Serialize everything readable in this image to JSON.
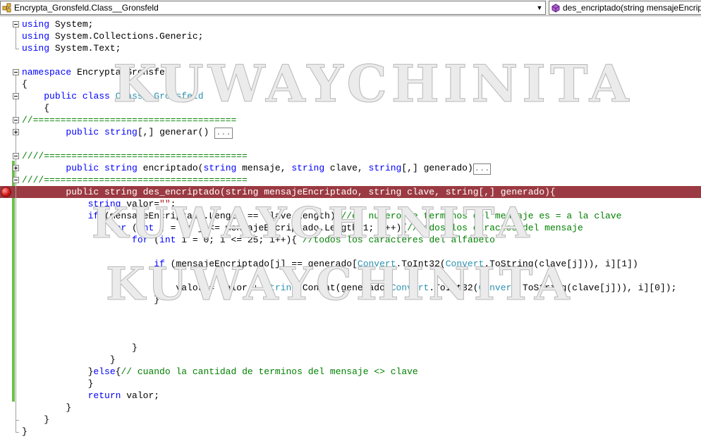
{
  "navigation": {
    "type_selector": "Encrypta_Gronsfeld.Class__Gronsfeld",
    "member_selector": "des_encriptado(string mensajeEncriptado, string clave, string[,] generado)",
    "dropdown_arrow": "▼"
  },
  "watermark": {
    "text": "KUWAYCHINITA"
  },
  "code_lines": [
    [
      {
        "t": "using",
        "c": "kw"
      },
      {
        "t": " System;"
      }
    ],
    [
      {
        "t": "using",
        "c": "kw"
      },
      {
        "t": " System.Collections.Generic;"
      }
    ],
    [
      {
        "t": "using",
        "c": "kw"
      },
      {
        "t": " System.Text;"
      }
    ],
    [
      {
        "t": ""
      }
    ],
    [
      {
        "t": "namespace",
        "c": "kw"
      },
      {
        "t": " Encrypta_Gronsfeld"
      }
    ],
    [
      {
        "t": "{"
      }
    ],
    [
      {
        "t": "    "
      },
      {
        "t": "public",
        "c": "kw"
      },
      {
        "t": " "
      },
      {
        "t": "class",
        "c": "kw"
      },
      {
        "t": " "
      },
      {
        "t": "Class__Gronsfeld",
        "c": "ty"
      }
    ],
    [
      {
        "t": "    {"
      }
    ],
    [
      {
        "t": "//=====================================",
        "c": "cm"
      }
    ],
    [
      {
        "t": "        "
      },
      {
        "t": "public",
        "c": "kw"
      },
      {
        "t": " "
      },
      {
        "t": "string",
        "c": "kw"
      },
      {
        "t": "[,] generar() "
      },
      {
        "t": "...",
        "c": "ellipsis"
      }
    ],
    [
      {
        "t": ""
      }
    ],
    [
      {
        "t": "////=====================================",
        "c": "cm"
      }
    ],
    [
      {
        "t": "        "
      },
      {
        "t": "public",
        "c": "kw"
      },
      {
        "t": " "
      },
      {
        "t": "string",
        "c": "kw"
      },
      {
        "t": " encriptado("
      },
      {
        "t": "string",
        "c": "kw"
      },
      {
        "t": " mensaje, "
      },
      {
        "t": "string",
        "c": "kw"
      },
      {
        "t": " clave, "
      },
      {
        "t": "string",
        "c": "kw"
      },
      {
        "t": "[,] generado)"
      },
      {
        "t": "...",
        "c": "ellipsis"
      }
    ],
    [
      {
        "t": "////=====================================",
        "c": "cm"
      }
    ],
    [
      {
        "t": "        public string des_encriptado(string mensajeEncriptado, string clave, string[,] generado){"
      }
    ],
    [
      {
        "t": "            "
      },
      {
        "t": "string",
        "c": "kw"
      },
      {
        "t": " valor="
      },
      {
        "t": "\"\"",
        "c": "st"
      },
      {
        "t": ";"
      }
    ],
    [
      {
        "t": "            "
      },
      {
        "t": "if",
        "c": "kw"
      },
      {
        "t": " (mensajeEncriptado.Length == clave.Length){"
      },
      {
        "t": "//el numero de terminos del mensaje es = a la clave",
        "c": "cm"
      }
    ],
    [
      {
        "t": "                "
      },
      {
        "t": "for",
        "c": "kw"
      },
      {
        "t": " ("
      },
      {
        "t": "int",
        "c": "kw"
      },
      {
        "t": " j = 0; j <= mensajeEncriptado.Length-1; j++){"
      },
      {
        "t": "//todos los caractes del mensaje",
        "c": "cm"
      }
    ],
    [
      {
        "t": "                    "
      },
      {
        "t": "for",
        "c": "kw"
      },
      {
        "t": " ("
      },
      {
        "t": "int",
        "c": "kw"
      },
      {
        "t": " i = 0; i <= 25; i++){ "
      },
      {
        "t": "//todos los caracteres del alfabeto",
        "c": "cm"
      }
    ],
    [
      {
        "t": ""
      }
    ],
    [
      {
        "t": "                        "
      },
      {
        "t": "if",
        "c": "kw"
      },
      {
        "t": " (mensajeEncriptado[j] == generado["
      },
      {
        "t": "Convert",
        "c": "ty"
      },
      {
        "t": ".ToInt32("
      },
      {
        "t": "Convert",
        "c": "ty"
      },
      {
        "t": ".ToString(clave[j])), i][1])"
      }
    ],
    [
      {
        "t": "                        {"
      }
    ],
    [
      {
        "t": "                            valor = valor + "
      },
      {
        "t": "String",
        "c": "ty"
      },
      {
        "t": ".Concat(generado["
      },
      {
        "t": "Convert",
        "c": "ty"
      },
      {
        "t": ".ToInt32("
      },
      {
        "t": "Convert",
        "c": "ty"
      },
      {
        "t": ".ToString(clave[j])), i][0]);"
      }
    ],
    [
      {
        "t": "                        }"
      }
    ],
    [
      {
        "t": ""
      }
    ],
    [
      {
        "t": ""
      }
    ],
    [
      {
        "t": ""
      }
    ],
    [
      {
        "t": "                    }"
      }
    ],
    [
      {
        "t": "                }"
      }
    ],
    [
      {
        "t": "            }"
      },
      {
        "t": "else",
        "c": "kw"
      },
      {
        "t": "{"
      },
      {
        "t": "// cuando la cantidad de terminos del mensaje <> clave",
        "c": "cm"
      }
    ],
    [
      {
        "t": "            }"
      }
    ],
    [
      {
        "t": "            "
      },
      {
        "t": "return",
        "c": "kw"
      },
      {
        "t": " valor;"
      }
    ],
    [
      {
        "t": "        }"
      }
    ],
    [
      {
        "t": "    }"
      }
    ],
    [
      {
        "t": "}"
      }
    ]
  ]
}
